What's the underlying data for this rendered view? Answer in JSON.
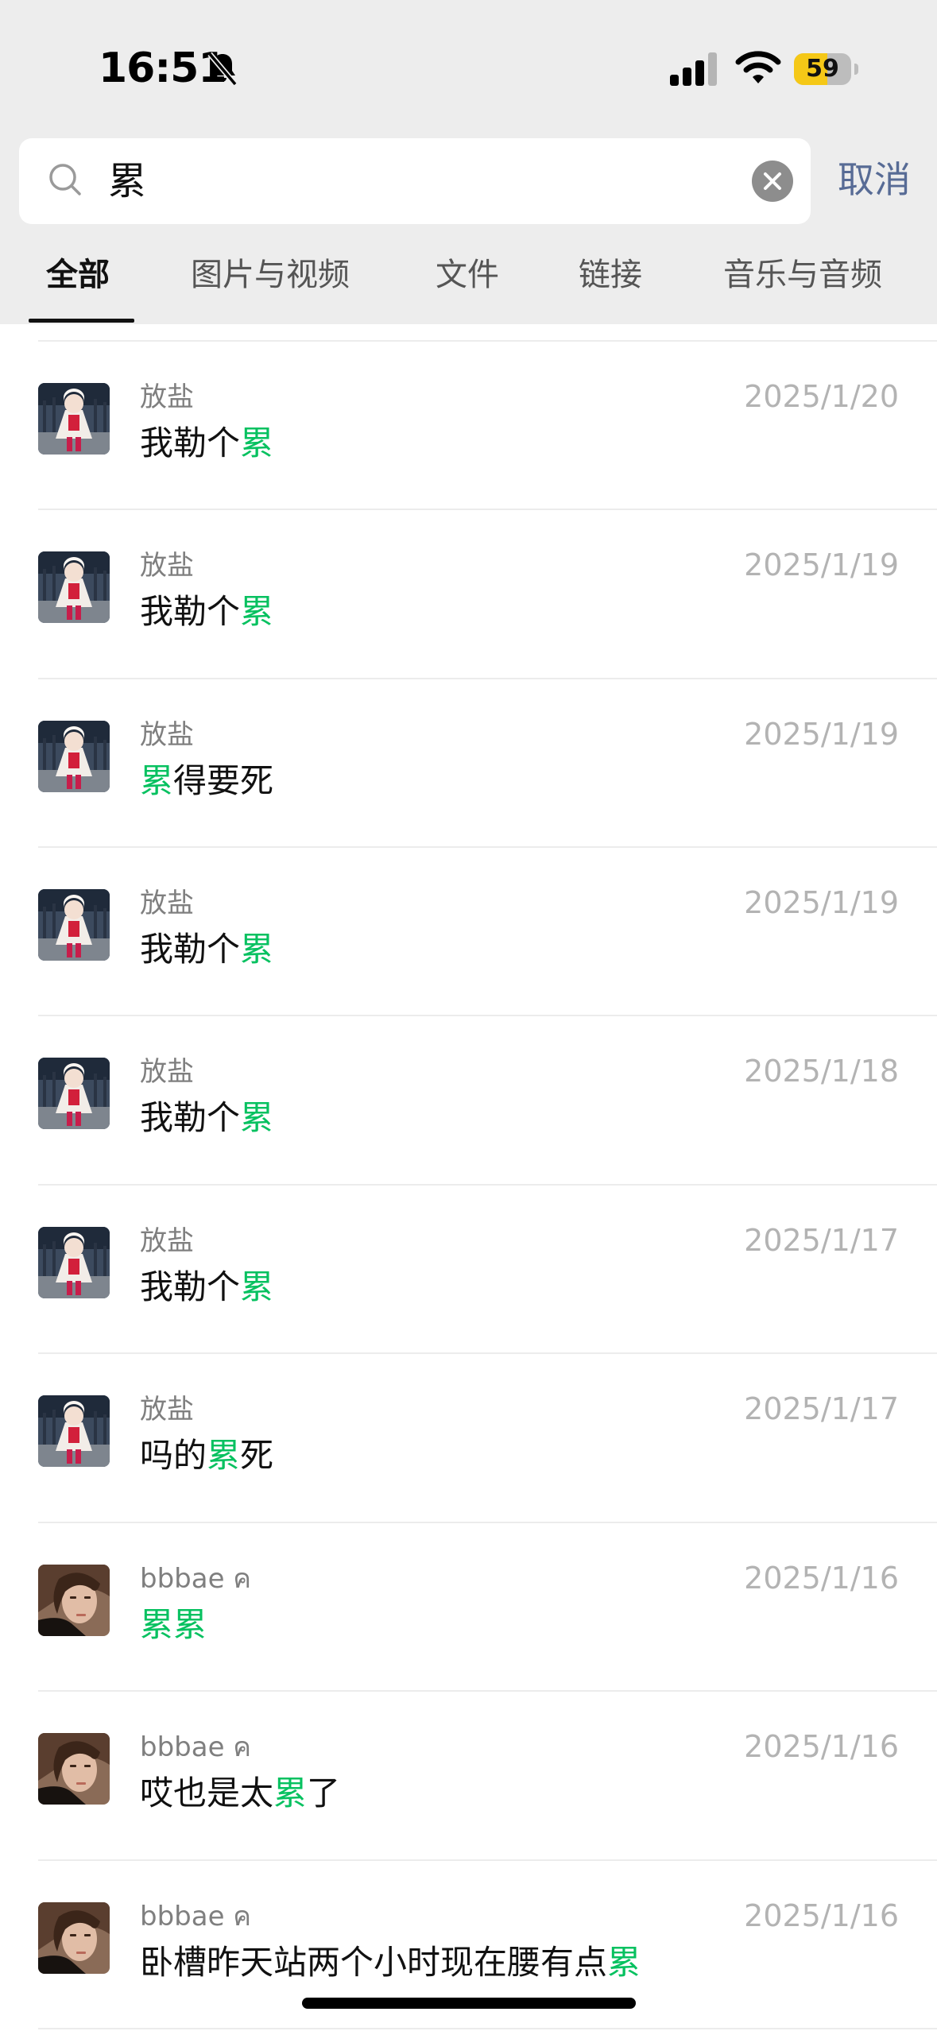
{
  "status_bar": {
    "time": "16:51",
    "battery_level": "59",
    "battery_fraction": 0.59,
    "battery_color": "#f5c817",
    "icons": [
      "bell-slash-icon",
      "cellular-signal-icon",
      "wifi-icon",
      "battery-icon"
    ]
  },
  "search": {
    "query": "累",
    "cancel_label": "取消"
  },
  "tabs": [
    {
      "label": "全部",
      "active": true
    },
    {
      "label": "图片与视频",
      "active": false
    },
    {
      "label": "文件",
      "active": false
    },
    {
      "label": "链接",
      "active": false
    },
    {
      "label": "音乐与音频",
      "active": false
    }
  ],
  "highlight_color": "#07c160",
  "results": [
    {
      "sender": "放盐",
      "date": "2025/1/20",
      "avatar": "child-photo",
      "parts": [
        {
          "text": "我勒个",
          "hl": false
        },
        {
          "text": "累",
          "hl": true
        }
      ]
    },
    {
      "sender": "放盐",
      "date": "2025/1/19",
      "avatar": "child-photo",
      "parts": [
        {
          "text": "我勒个",
          "hl": false
        },
        {
          "text": "累",
          "hl": true
        }
      ]
    },
    {
      "sender": "放盐",
      "date": "2025/1/19",
      "avatar": "child-photo",
      "parts": [
        {
          "text": "累",
          "hl": true
        },
        {
          "text": "得要死",
          "hl": false
        }
      ]
    },
    {
      "sender": "放盐",
      "date": "2025/1/19",
      "avatar": "child-photo",
      "parts": [
        {
          "text": "我勒个",
          "hl": false
        },
        {
          "text": "累",
          "hl": true
        }
      ]
    },
    {
      "sender": "放盐",
      "date": "2025/1/18",
      "avatar": "child-photo",
      "parts": [
        {
          "text": "我勒个",
          "hl": false
        },
        {
          "text": "累",
          "hl": true
        }
      ]
    },
    {
      "sender": "放盐",
      "date": "2025/1/17",
      "avatar": "child-photo",
      "parts": [
        {
          "text": "我勒个",
          "hl": false
        },
        {
          "text": "累",
          "hl": true
        }
      ]
    },
    {
      "sender": "放盐",
      "date": "2025/1/17",
      "avatar": "child-photo",
      "parts": [
        {
          "text": "吗的",
          "hl": false
        },
        {
          "text": "累",
          "hl": true
        },
        {
          "text": "死",
          "hl": false
        }
      ]
    },
    {
      "sender": "bbbae ค",
      "date": "2025/1/16",
      "avatar": "woman-photo",
      "parts": [
        {
          "text": "累累",
          "hl": true
        }
      ]
    },
    {
      "sender": "bbbae ค",
      "date": "2025/1/16",
      "avatar": "woman-photo",
      "parts": [
        {
          "text": "哎也是太",
          "hl": false
        },
        {
          "text": "累",
          "hl": true
        },
        {
          "text": "了",
          "hl": false
        }
      ]
    },
    {
      "sender": "bbbae ค",
      "date": "2025/1/16",
      "avatar": "woman-photo",
      "parts": [
        {
          "text": "卧槽昨天站两个小时现在腰有点",
          "hl": false
        },
        {
          "text": "累",
          "hl": true
        }
      ]
    }
  ]
}
